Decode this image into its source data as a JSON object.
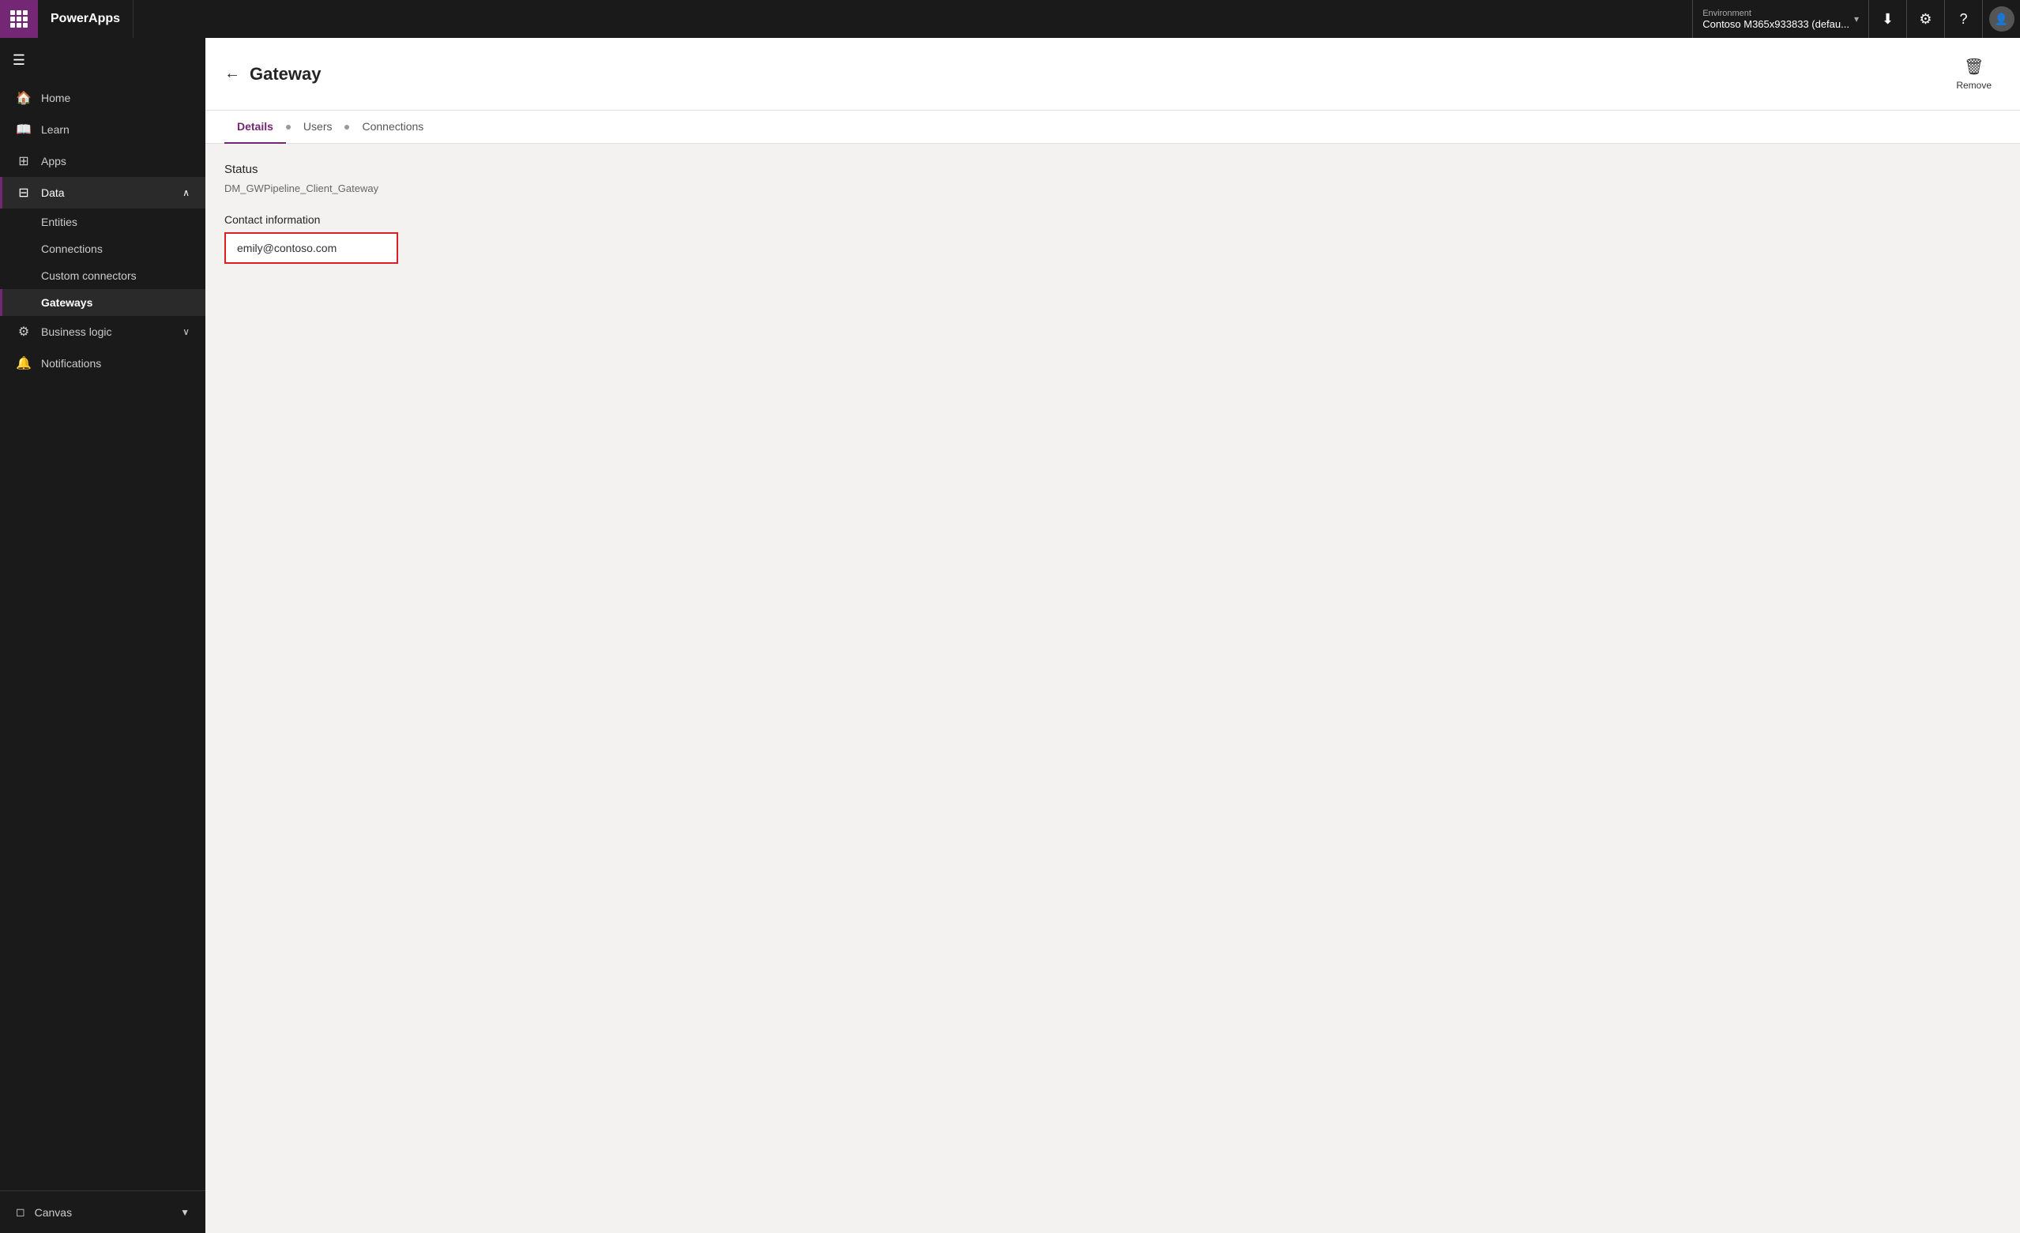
{
  "topbar": {
    "app_name": "PowerApps",
    "environment_label": "Environment",
    "environment_value": "Contoso M365x933833 (defau...",
    "download_icon": "⬇",
    "settings_icon": "⚙",
    "help_icon": "?",
    "avatar_initial": ""
  },
  "sidebar": {
    "menu_icon": "☰",
    "items": [
      {
        "id": "home",
        "label": "Home",
        "icon": "🏠",
        "active": false
      },
      {
        "id": "learn",
        "label": "Learn",
        "icon": "📖",
        "active": false
      },
      {
        "id": "apps",
        "label": "Apps",
        "icon": "⊞",
        "active": false
      },
      {
        "id": "data",
        "label": "Data",
        "icon": "⊞",
        "active": true,
        "expanded": true
      }
    ],
    "data_sub_items": [
      {
        "id": "entities",
        "label": "Entities",
        "active": false
      },
      {
        "id": "connections",
        "label": "Connections",
        "active": false
      },
      {
        "id": "custom-connectors",
        "label": "Custom connectors",
        "active": false
      },
      {
        "id": "gateways",
        "label": "Gateways",
        "active": true
      }
    ],
    "bottom_items": [
      {
        "id": "business-logic",
        "label": "Business logic",
        "icon": "⚙",
        "active": false
      },
      {
        "id": "notifications",
        "label": "Notifications",
        "icon": "🔔",
        "active": false
      }
    ],
    "footer": {
      "item_label": "Canvas",
      "item_icon": "◻",
      "chevron": "▼"
    }
  },
  "page": {
    "title": "Gateway",
    "back_label": "←",
    "remove_label": "Remove",
    "tabs": [
      {
        "id": "details",
        "label": "Details",
        "active": true,
        "has_dot": false
      },
      {
        "id": "users",
        "label": "Users",
        "active": false,
        "has_dot": true
      },
      {
        "id": "connections",
        "label": "Connections",
        "active": false,
        "has_dot": true
      }
    ],
    "status_label": "Status",
    "status_value": "DM_GWPipeline_Client_Gateway",
    "contact_label": "Contact information",
    "contact_value": "emily@contoso.com"
  }
}
